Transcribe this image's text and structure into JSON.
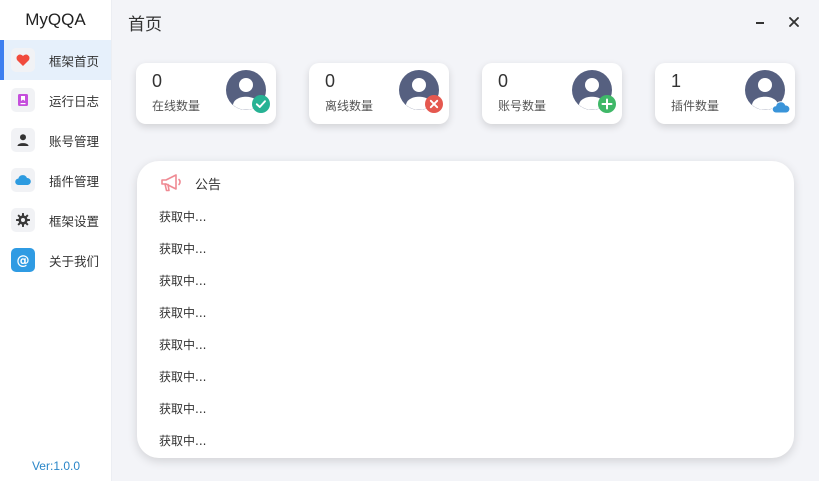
{
  "app": {
    "title": "MyQQA",
    "version": "Ver:1.0.0"
  },
  "sidebar": {
    "items": [
      {
        "label": "框架首页",
        "icon": "heart-icon",
        "active": true
      },
      {
        "label": "运行日志",
        "icon": "bookmark-icon"
      },
      {
        "label": "账号管理",
        "icon": "user-icon"
      },
      {
        "label": "插件管理",
        "icon": "cloud-icon"
      },
      {
        "label": "框架设置",
        "icon": "gear-icon"
      },
      {
        "label": "关于我们",
        "icon": "at-icon"
      }
    ]
  },
  "header": {
    "title": "首页"
  },
  "stats": [
    {
      "value": "0",
      "label": "在线数量",
      "badge": "check-icon",
      "badge_color": "#27b294"
    },
    {
      "value": "0",
      "label": "离线数量",
      "badge": "x-icon",
      "badge_color": "#e5584f"
    },
    {
      "value": "0",
      "label": "账号数量",
      "badge": "plus-icon",
      "badge_color": "#3fb868"
    },
    {
      "value": "1",
      "label": "插件数量",
      "badge": "cloud-icon",
      "badge_color": "#3a94d9"
    }
  ],
  "notice": {
    "title": "公告",
    "items": [
      "获取中...",
      "获取中...",
      "获取中...",
      "获取中...",
      "获取中...",
      "获取中...",
      "获取中...",
      "获取中..."
    ]
  },
  "colors": {
    "accent": "#3d7ff0",
    "avatar": "#566080",
    "background": "#f3f4f8",
    "version": "#2a86c8"
  }
}
